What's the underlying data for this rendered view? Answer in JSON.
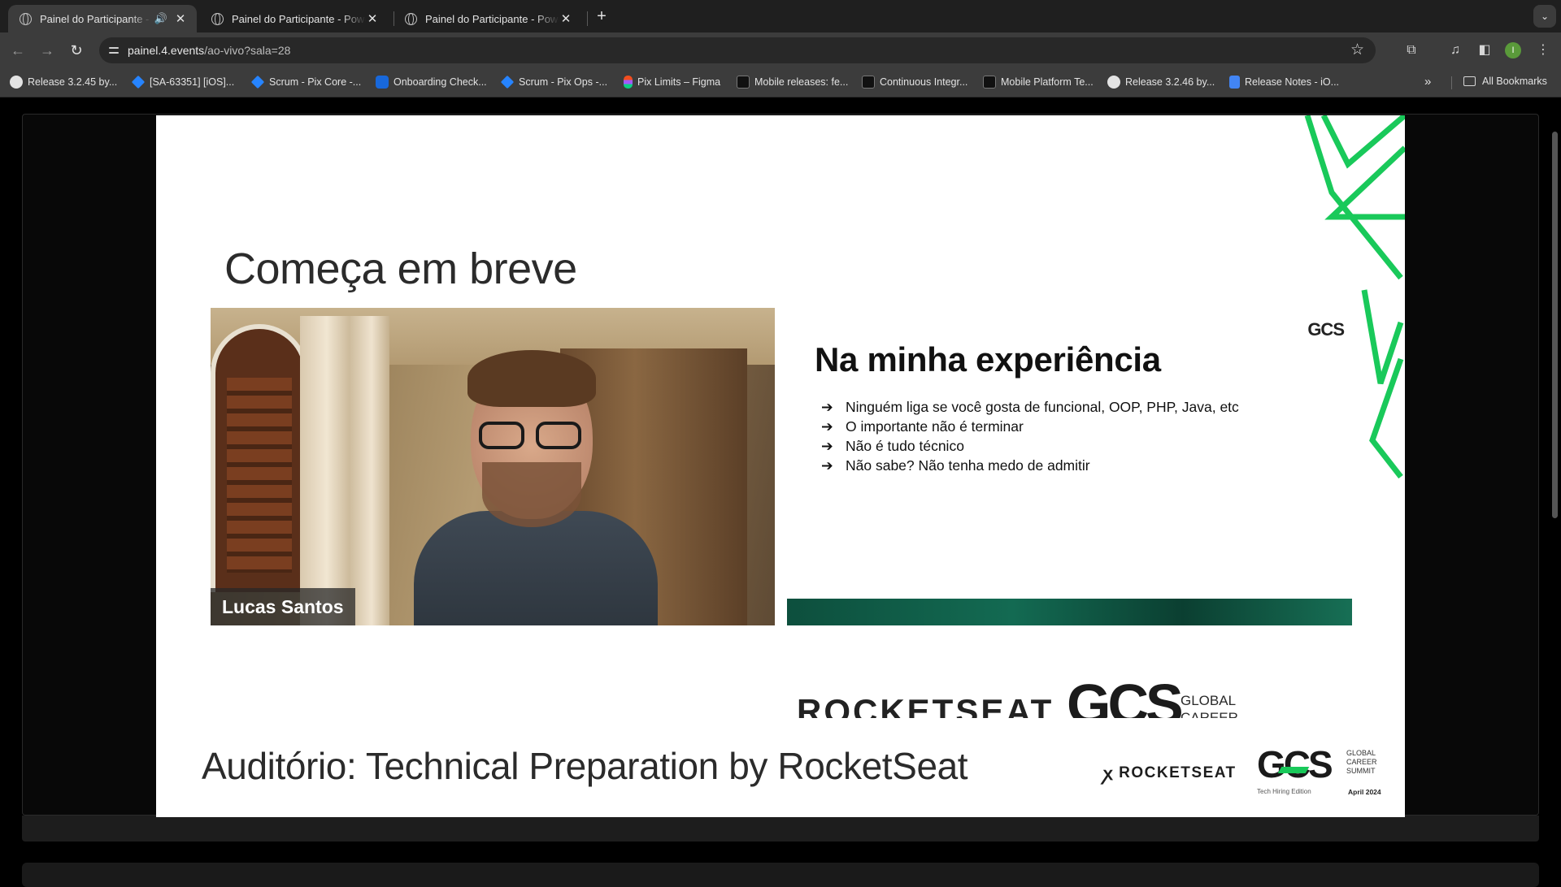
{
  "browser": {
    "tabs": [
      {
        "title": "Painel do Participante - Powe",
        "active": true,
        "audio": true
      },
      {
        "title": "Painel do Participante - Powe",
        "active": false,
        "audio": false
      },
      {
        "title": "Painel do Participante - Powe",
        "active": false,
        "audio": false
      }
    ],
    "url_host": "painel.4.events",
    "url_path": "/ao-vivo?sala=28",
    "profile_initial": "I",
    "bookmarks": [
      {
        "label": "Release 3.2.45 by...",
        "icon": "github-icon"
      },
      {
        "label": "[SA-63351] [iOS]...",
        "icon": "jira-icon"
      },
      {
        "label": "Scrum - Pix Core -...",
        "icon": "jira-icon"
      },
      {
        "label": "Onboarding Check...",
        "icon": "confluence-icon"
      },
      {
        "label": "Scrum - Pix Ops -...",
        "icon": "jira-icon"
      },
      {
        "label": "Pix Limits – Figma",
        "icon": "figma-icon"
      },
      {
        "label": "Mobile releases: fe...",
        "icon": "ci-icon"
      },
      {
        "label": "Continuous Integr...",
        "icon": "ci-icon"
      },
      {
        "label": "Mobile Platform Te...",
        "icon": "ci-icon"
      },
      {
        "label": "Release 3.2.46 by...",
        "icon": "github-icon"
      },
      {
        "label": "Release Notes - iO...",
        "icon": "docs-icon"
      }
    ],
    "all_bookmarks_label": "All Bookmarks"
  },
  "slide": {
    "heading": "Começa em breve",
    "speaker_name": "Lucas Santos",
    "inner_slide": {
      "title": "Na minha experiência",
      "logo_text": "GCS",
      "bullets": [
        "Ninguém liga se você gosta de funcional, OOP, PHP, Java, etc",
        "O importante não é terminar",
        "Não é tudo técnico",
        "Não sabe? Não tenha medo de admitir"
      ],
      "arrow_glyph": "➔"
    },
    "sponsor_strip": {
      "rocketseat": "ROCKETSEAT",
      "gcs": "GCS",
      "global_career": "GLOBAL\nCAREER"
    },
    "room_title": "Auditório: Technical Preparation by RocketSeat",
    "footer": {
      "rocketseat": "ROCKETSEAT",
      "gcs": "GCS",
      "summit_words": "GLOBAL\nCAREER\nSUMMIT",
      "edition": "Tech Hiring Edition",
      "date": "April 2024"
    },
    "accent_green": "#19c95a",
    "band_green": "#136a52"
  }
}
